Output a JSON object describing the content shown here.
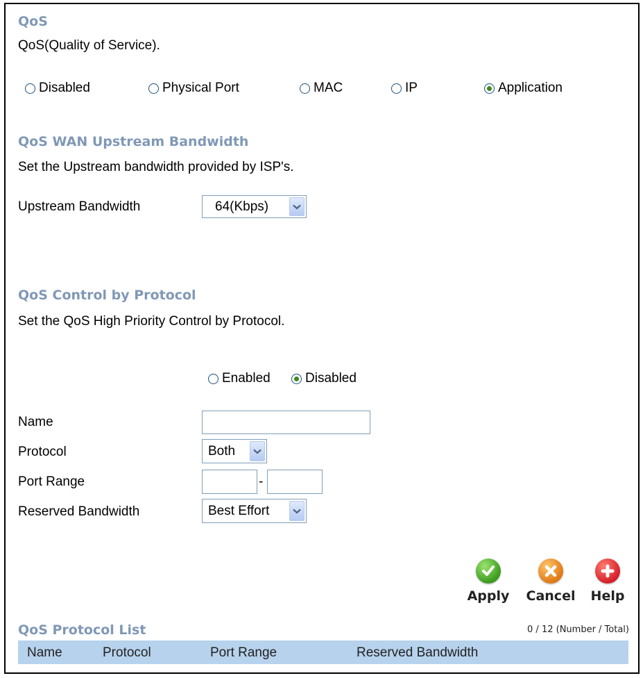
{
  "qos": {
    "title": "QoS",
    "description": "QoS(Quality of Service).",
    "modes": [
      {
        "label": "Disabled",
        "checked": false
      },
      {
        "label": "Physical Port",
        "checked": false
      },
      {
        "label": "MAC",
        "checked": false
      },
      {
        "label": "IP",
        "checked": false
      },
      {
        "label": "Application",
        "checked": true
      }
    ]
  },
  "upstream": {
    "title": "QoS WAN Upstream Bandwidth",
    "description": "Set the Upstream bandwidth provided by ISP's.",
    "bandwidth_label": "Upstream Bandwidth",
    "bandwidth_value": "64(Kbps)"
  },
  "protocol_control": {
    "title": "QoS Control by Protocol",
    "description": "Set the QoS High Priority Control by Protocol.",
    "enabled_label": "Enabled",
    "disabled_label": "Disabled",
    "selected": "Disabled",
    "name_label": "Name",
    "name_value": "",
    "protocol_label": "Protocol",
    "protocol_value": "Both",
    "port_range_label": "Port Range",
    "port_range_separator": "-",
    "port_start": "",
    "port_end": "",
    "reserved_label": "Reserved Bandwidth",
    "reserved_value": "Best Effort"
  },
  "actions": {
    "apply": "Apply",
    "cancel": "Cancel",
    "help": "Help"
  },
  "protocol_list": {
    "title": "QoS Protocol List",
    "count": "0 / 12 (Number / Total)",
    "columns": [
      "Name",
      "Protocol",
      "Port Range",
      "Reserved Bandwidth"
    ]
  },
  "colors": {
    "section_title": "#8098b6",
    "list_header_bg": "#b7d2ec",
    "apply": "#3b9b1e",
    "cancel": "#e07a16",
    "help": "#d6202a"
  }
}
